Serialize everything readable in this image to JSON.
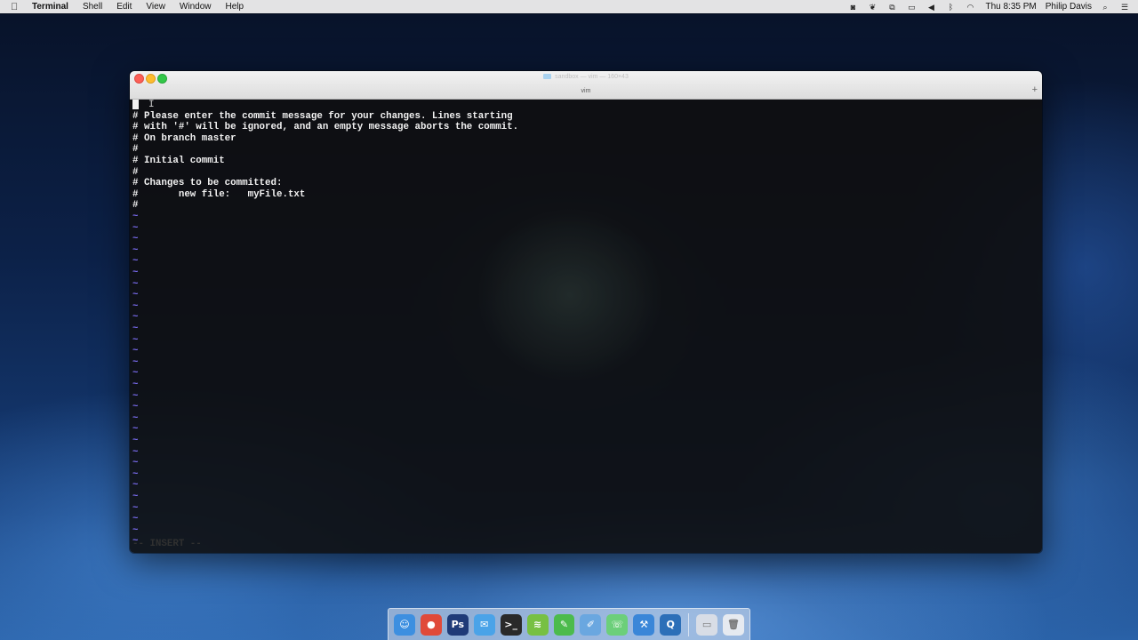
{
  "menubar": {
    "app_name": "Terminal",
    "menus": [
      "Shell",
      "Edit",
      "View",
      "Window",
      "Help"
    ],
    "status": {
      "clock": "Thu 8:35 PM",
      "user": "Philip Davis",
      "icons": [
        "screen-record-icon",
        "evernote-icon",
        "dropbox-icon",
        "airplay-icon",
        "volume-icon",
        "bluetooth-icon",
        "wifi-icon",
        "spotlight-icon",
        "notification-center-icon"
      ]
    }
  },
  "window": {
    "title": "sandbox — vim — 160×43",
    "tab_label": "vim",
    "new_tab_glyph": "+"
  },
  "editor": {
    "lines": [
      "",
      "# Please enter the commit message for your changes. Lines starting",
      "# with '#' will be ignored, and an empty message aborts the commit.",
      "# On branch master",
      "#",
      "# Initial commit",
      "#",
      "# Changes to be committed:",
      "#       new file:   myFile.txt",
      "#"
    ],
    "tilde": "~",
    "tilde_count": 30,
    "mode": "-- INSERT --"
  },
  "dock": {
    "apps": [
      {
        "name": "finder-icon",
        "glyph": "☺",
        "color": "#3d8fe0"
      },
      {
        "name": "chrome-icon",
        "glyph": "●",
        "color": "#e04a3a"
      },
      {
        "name": "photoshop-icon",
        "glyph": "Ps",
        "color": "#1f3b78"
      },
      {
        "name": "mail-icon",
        "glyph": "✉",
        "color": "#4aa3e8"
      },
      {
        "name": "terminal-icon",
        "glyph": ">_",
        "color": "#2a2a2a"
      },
      {
        "name": "spotify-icon",
        "glyph": "≋",
        "color": "#77c043"
      },
      {
        "name": "evernote-icon",
        "glyph": "✎",
        "color": "#4cbb4c"
      },
      {
        "name": "textedit-icon",
        "glyph": "✐",
        "color": "#6aa7e0"
      },
      {
        "name": "messages-icon",
        "glyph": "☏",
        "color": "#6ccf7a"
      },
      {
        "name": "xcode-icon",
        "glyph": "⚒",
        "color": "#3a86d8"
      },
      {
        "name": "quicktime-icon",
        "glyph": "Q",
        "color": "#2c6fb8"
      }
    ],
    "trailing": [
      {
        "name": "downloads-stack-icon",
        "glyph": "▭",
        "color": "#d8dde6"
      },
      {
        "name": "trash-icon",
        "glyph": "🗑",
        "color": "#e6eaf0"
      }
    ]
  }
}
